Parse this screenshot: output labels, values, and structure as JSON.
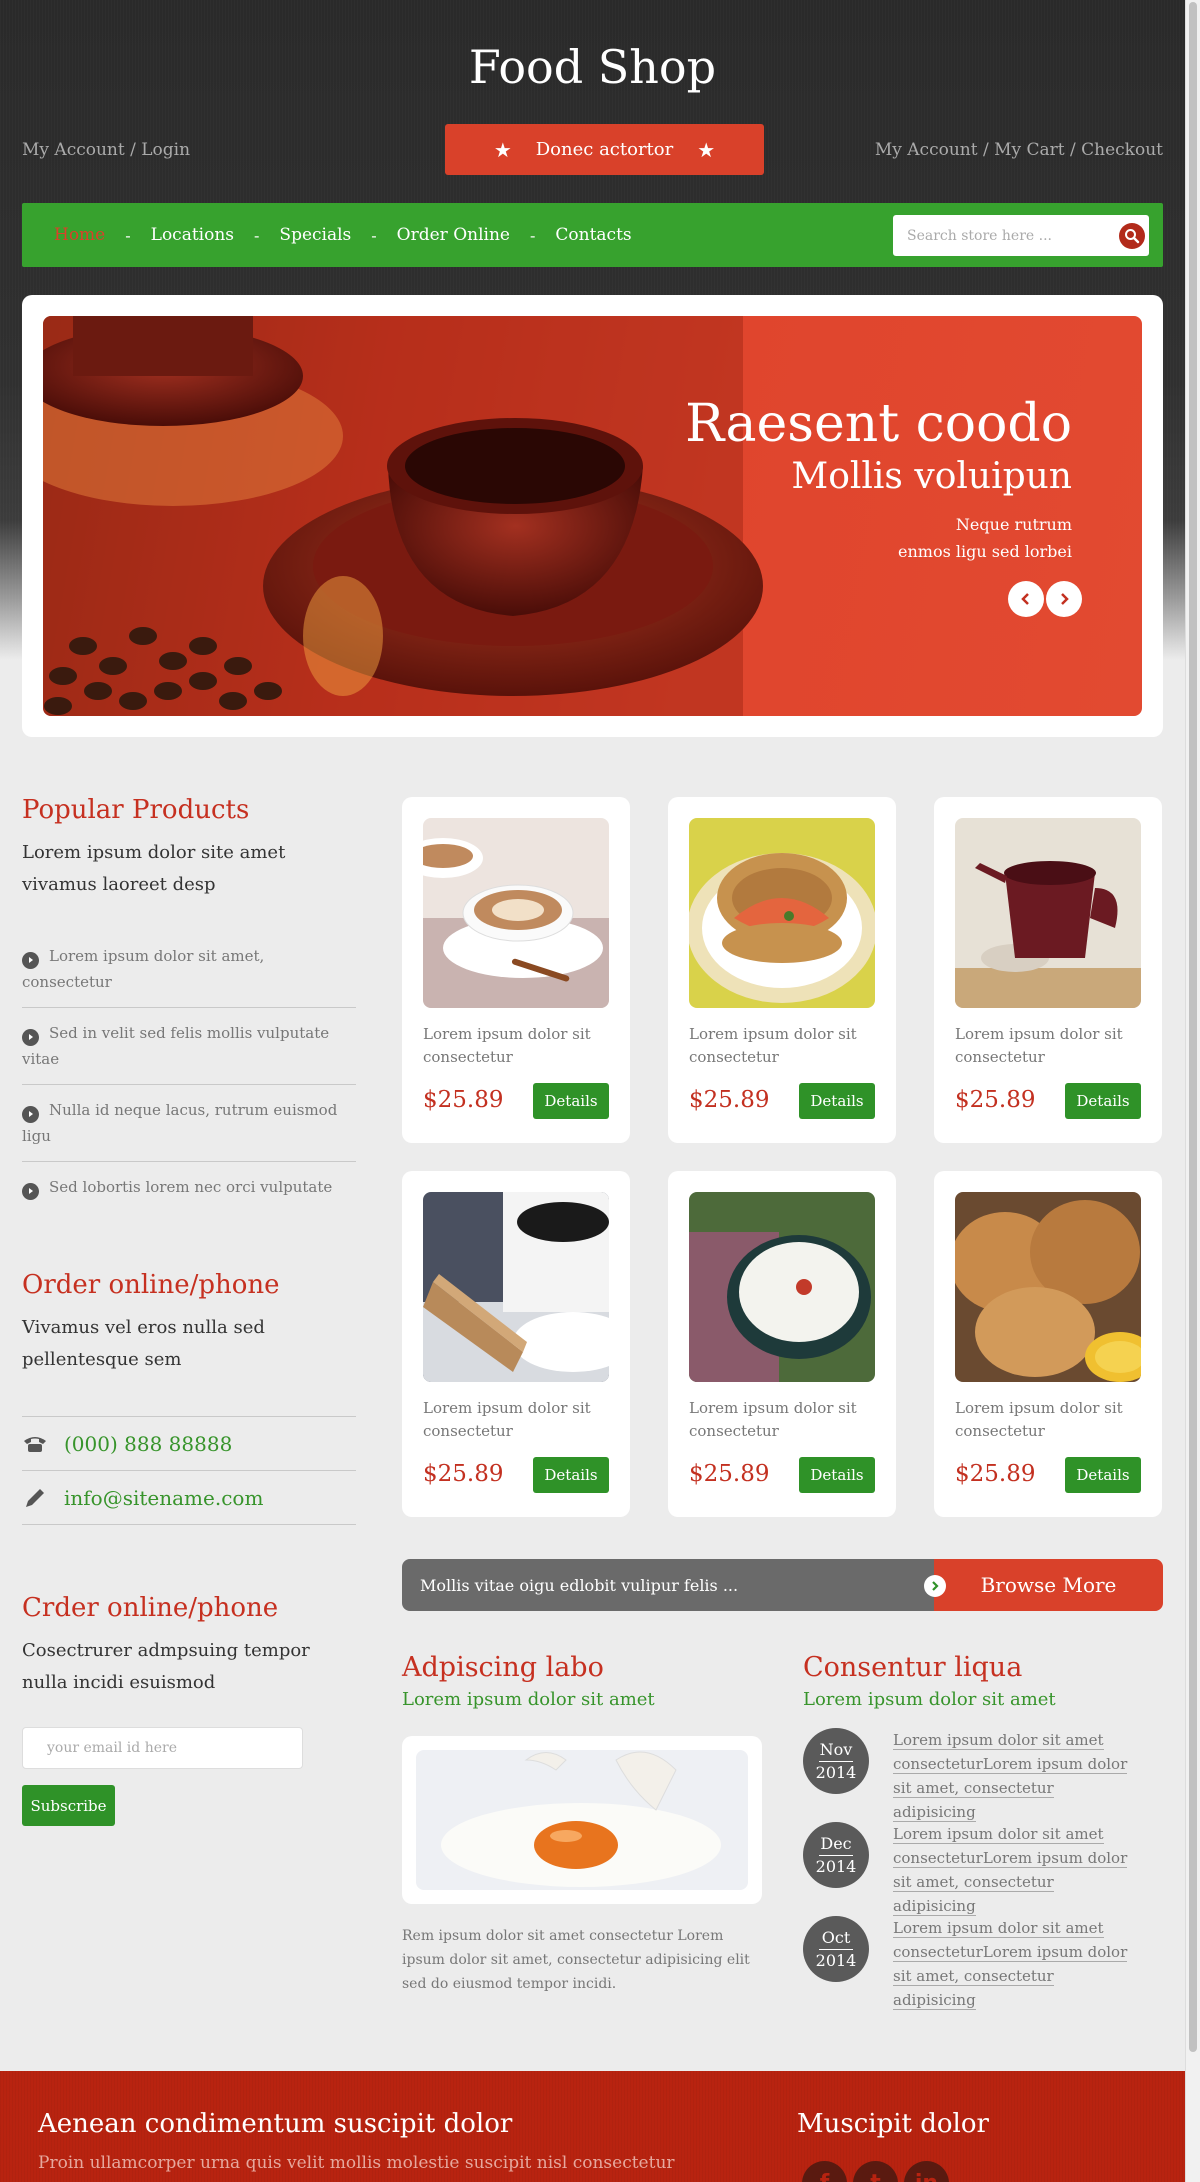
{
  "header": {
    "site_title": "Food Shop",
    "account_left": "My Account / Login",
    "account_right": "My Account / My Cart / Checkout",
    "promo_label": "Donec actortor"
  },
  "nav": {
    "items": [
      "Home",
      "Locations",
      "Specials",
      "Order Online",
      "Contacts"
    ],
    "separator": "-",
    "active_index": 0,
    "search_placeholder": "Search store here ..."
  },
  "slider": {
    "title": "Raesent coodo",
    "subtitle": "Mollis voluipun",
    "text_line1": "Neque rutrum",
    "text_line2": "enmos ligu sed lorbei"
  },
  "popular": {
    "heading": "Popular Products",
    "subheading": "Lorem ipsum dolor site amet vivamus laoreet desp",
    "items": [
      "Lorem ipsum dolor sit amet, consectetur",
      "Sed in velit sed felis mollis vulputate vitae",
      "Nulla id neque lacus, rutrum euismod ligu",
      "Sed lobortis lorem nec orci vulputate"
    ]
  },
  "order_phone": {
    "heading": "Order online/phone",
    "subheading": "Vivamus vel eros nulla sed pellentesque sem",
    "phone": "(000) 888 88888",
    "email": "info@sitename.com"
  },
  "newsletter": {
    "heading": "Crder online/phone",
    "subheading": "Cosectrurer admpsuing tempor nulla incidi esuismod",
    "email_placeholder": "your email id here",
    "subscribe_label": "Subscribe"
  },
  "products": [
    {
      "name": "Lorem ipsum dolor sit consectetur",
      "price": "$25.89",
      "button": "Details",
      "image": "cappuccino"
    },
    {
      "name": "Lorem ipsum dolor sit consectetur",
      "price": "$25.89",
      "button": "Details",
      "image": "salmon-bagel"
    },
    {
      "name": "Lorem ipsum dolor sit consectetur",
      "price": "$25.89",
      "button": "Details",
      "image": "tea-pot"
    },
    {
      "name": "Lorem ipsum dolor sit consectetur",
      "price": "$25.89",
      "button": "Details",
      "image": "coffee-biscotti"
    },
    {
      "name": "Lorem ipsum dolor sit consectetur",
      "price": "$25.89",
      "button": "Details",
      "image": "rice-porridge"
    },
    {
      "name": "Lorem ipsum dolor sit consectetur",
      "price": "$25.89",
      "button": "Details",
      "image": "scones"
    }
  ],
  "browse": {
    "text": "Mollis vitae oigu edlobit vulipur felis ...",
    "button": "Browse More"
  },
  "blog": {
    "heading": "Adpiscing labo",
    "subheading": "Lorem ipsum dolor sit amet",
    "text": "Rem ipsum dolor sit amet consectetur Lorem ipsum dolor sit amet, consectetur adipisicing elit sed do eiusmod tempor incidi."
  },
  "news": {
    "heading": "Consentur liqua",
    "subheading": "Lorem ipsum dolor sit amet",
    "items": [
      {
        "month": "Nov",
        "year": "2014",
        "text": "Lorem ipsum dolor sit amet consecteturLorem ipsum dolor sit amet, consectetur adipisicing"
      },
      {
        "month": "Dec",
        "year": "2014",
        "text": "Lorem ipsum dolor sit amet consecteturLorem ipsum dolor sit amet, consectetur adipisicing"
      },
      {
        "month": "Oct",
        "year": "2014",
        "text": "Lorem ipsum dolor sit amet consecteturLorem ipsum dolor sit amet, consectetur adipisicing"
      }
    ]
  },
  "footer": {
    "heading_left": "Aenean condimentum suscipit dolor",
    "text_left": "Proin ullamcorper urna quis velit mollis molestie suscipit nisl consectetur",
    "heading_right": "Muscipit dolor",
    "socials": [
      "facebook-icon",
      "tumblr-icon",
      "linkedin-icon"
    ]
  },
  "colors": {
    "brand_red": "#d9412a",
    "nav_green": "#37a22e",
    "button_green": "#2f9228",
    "footer_red": "#b82310"
  }
}
